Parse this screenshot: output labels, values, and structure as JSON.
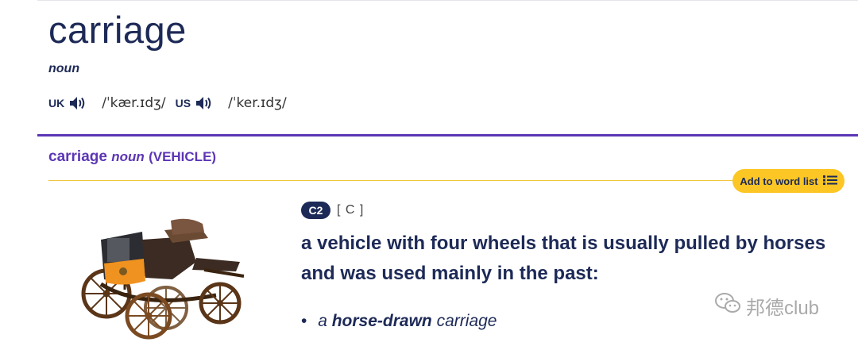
{
  "entry": {
    "headword": "carriage",
    "part_of_speech": "noun",
    "pronunciations": [
      {
        "region": "UK",
        "ipa": "/ˈkær.ɪdʒ/"
      },
      {
        "region": "US",
        "ipa": "/ˈker.ɪdʒ/"
      }
    ]
  },
  "sense": {
    "headword": "carriage",
    "pos": "noun",
    "guideword": "(VEHICLE)",
    "add_to_word_list": "Add to word list",
    "level": "C2",
    "grammar": "[ C ]",
    "definition": "a vehicle with four wheels that is usually pulled by horses and was used mainly in the past:",
    "example": {
      "prefix": "a",
      "bold": "horse-drawn",
      "suffix": "carriage"
    }
  },
  "watermark": "邦德club",
  "icons": {
    "speaker": "speaker-icon",
    "list": "list-icon",
    "picture": "carriage-image",
    "wechat": "wechat-icon"
  },
  "colors": {
    "navy": "#1d2a57",
    "purple": "#5c36b5",
    "yellow": "#fcc624"
  }
}
